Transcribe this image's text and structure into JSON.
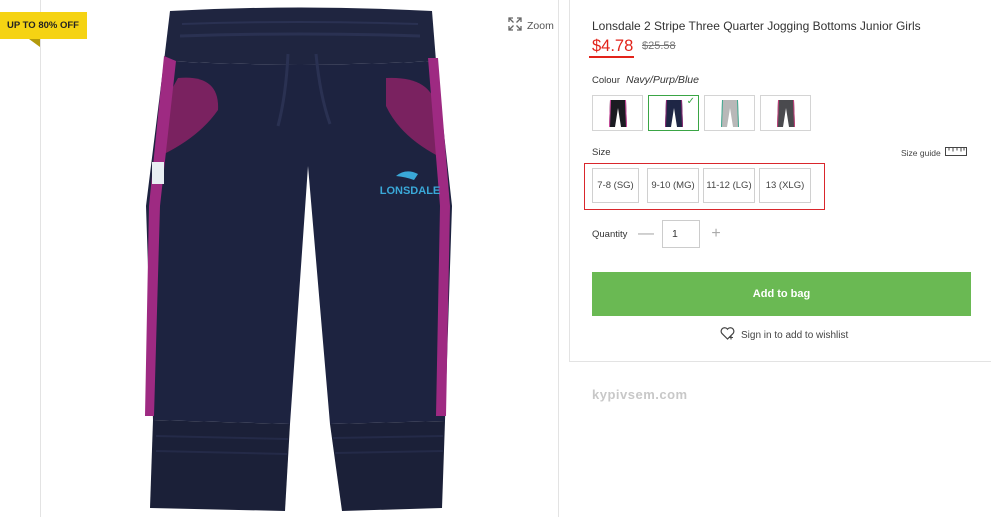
{
  "promo": {
    "badge": "UP TO 80% OFF"
  },
  "image": {
    "zoom_label": "Zoom",
    "product": "navy jogging bottoms with purple stripe",
    "logo_text": "LONSDALE"
  },
  "product": {
    "title": "Lonsdale 2 Stripe Three Quarter Jogging Bottoms Junior Girls",
    "price": "$4.78",
    "was_price": "$25.58"
  },
  "colour": {
    "label": "Colour",
    "selected": "Navy/Purp/Blue",
    "swatches": [
      {
        "name": "black",
        "color": "#1b1b22",
        "accent": "#d04aa0"
      },
      {
        "name": "navy",
        "color": "#1e2645",
        "accent": "#8a2a74"
      },
      {
        "name": "grey",
        "color": "#b8b8b8",
        "accent": "#3ea88f"
      },
      {
        "name": "charcoal",
        "color": "#4a4a4e",
        "accent": "#c43e7a"
      }
    ]
  },
  "size": {
    "label": "Size",
    "guide_label": "Size guide",
    "options": [
      "7-8 (SG)",
      "9-10 (MG)",
      "11-12 (LG)",
      "13 (XLG)"
    ]
  },
  "quantity": {
    "label": "Quantity",
    "value": "1",
    "minus": "—",
    "plus": "+"
  },
  "add_to_bag": "Add to bag",
  "wishlist": "Sign in to add to wishlist",
  "watermark": "kypivsem.com",
  "colors": {
    "accent_green": "#6ab953",
    "price_red": "#e2231a",
    "badge_yellow": "#f5d313",
    "highlight_red": "#d9262c"
  }
}
